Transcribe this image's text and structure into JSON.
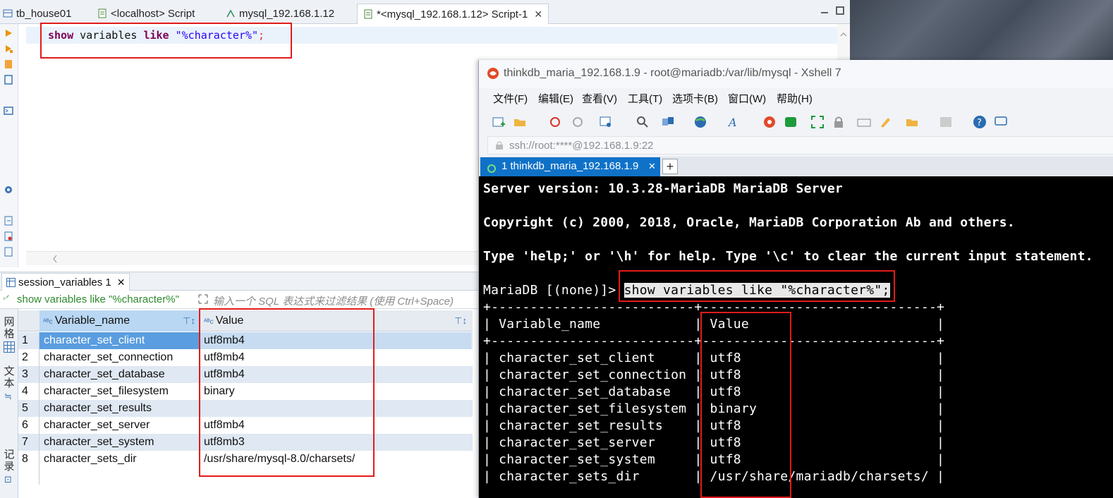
{
  "dbeaver": {
    "tabs": [
      {
        "label": "tb_house01"
      },
      {
        "label": "<localhost> Script"
      },
      {
        "label": "mysql_192.168.1.12"
      },
      {
        "label": "*<mysql_192.168.1.12> Script-1"
      }
    ],
    "editor": {
      "kw1": "show",
      "mid": " variables ",
      "kw2": "like",
      "str": " \"%character%\"",
      "end": ";"
    },
    "results": {
      "tab_label": "session_variables 1",
      "filter_query": "show variables like \"%character%\"",
      "filter_placeholder": "输入一个 SQL 表达式来过滤结果 (使用 Ctrl+Space)",
      "side_labels": [
        "网格",
        "文本",
        "记录"
      ],
      "columns": [
        "Variable_name",
        "Value"
      ],
      "rows": [
        {
          "n": "1",
          "name": "character_set_client",
          "value": "utf8mb4"
        },
        {
          "n": "2",
          "name": "character_set_connection",
          "value": "utf8mb4"
        },
        {
          "n": "3",
          "name": "character_set_database",
          "value": "utf8mb4"
        },
        {
          "n": "4",
          "name": "character_set_filesystem",
          "value": "binary"
        },
        {
          "n": "5",
          "name": "character_set_results",
          "value": ""
        },
        {
          "n": "6",
          "name": "character_set_server",
          "value": "utf8mb4"
        },
        {
          "n": "7",
          "name": "character_set_system",
          "value": "utf8mb3"
        },
        {
          "n": "8",
          "name": "character_sets_dir",
          "value": "/usr/share/mysql-8.0/charsets/"
        }
      ]
    }
  },
  "xshell": {
    "title": "thinkdb_maria_192.168.1.9 - root@mariadb:/var/lib/mysql - Xshell 7",
    "menu": [
      "文件(F)",
      "编辑(E)",
      "查看(V)",
      "工具(T)",
      "选项卡(B)",
      "窗口(W)",
      "帮助(H)"
    ],
    "address": "ssh://root:****@192.168.1.9:22",
    "session_tab": "1 thinkdb_maria_192.168.1.9",
    "plus": "+",
    "terminal": {
      "line1": "Server version: 10.3.28-MariaDB MariaDB Server",
      "line2": "Copyright (c) 2000, 2018, Oracle, MariaDB Corporation Ab and others.",
      "line3": "Type 'help;' or '\\h' for help. Type '\\c' to clear the current input statement.",
      "prompt": "MariaDB [(none)]> ",
      "command": "show variables like \"%character%\";",
      "border": "+--------------------------+------------------------------+",
      "header": "| Variable_name            | Value                        |",
      "rows": [
        "| character_set_client     | utf8                         |",
        "| character_set_connection | utf8                         |",
        "| character_set_database   | utf8                         |",
        "| character_set_filesystem | binary                       |",
        "| character_set_results    | utf8                         |",
        "| character_set_server     | utf8                         |",
        "| character_set_system     | utf8                         |",
        "| character_sets_dir       | /usr/share/mariadb/charsets/ |"
      ]
    }
  }
}
